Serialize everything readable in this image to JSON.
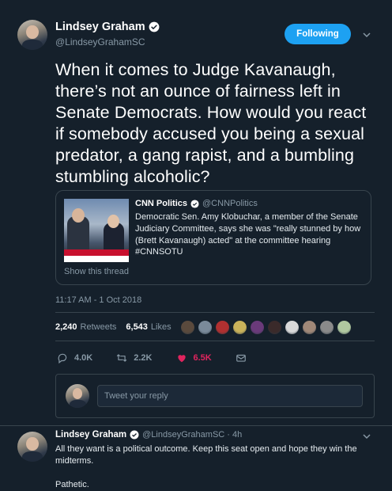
{
  "tweet": {
    "author_name": "Lindsey Graham",
    "handle": "@LindseyGrahamSC",
    "follow_label": "Following",
    "text": "When it comes to Judge Kavanaugh, there’s not an ounce of fairness left in Senate Democrats. How would you react if somebody accused you being a sexual predator, a gang rapist, and a bumbling stumbling alcoholic?",
    "timestamp": "11:17 AM - 1 Oct 2018"
  },
  "quoted_tweet": {
    "author_name": "CNN Politics",
    "handle": "@CNNPolitics",
    "text": "Democratic Sen. Amy Klobuchar, a member of the Senate Judiciary Committee, says she was \"really stunned by how (Brett Kavanaugh) acted\" at the committee hearing #CNNSOTU",
    "show_thread": "Show this thread"
  },
  "stats": {
    "retweets_count": "2,240",
    "retweets_label": "Retweets",
    "likes_count": "6,543",
    "likes_label": "Likes"
  },
  "likers_colors": [
    "#5a4a3d",
    "#7a8a9a",
    "#b03030",
    "#c9b25a",
    "#6a3a7a",
    "#3a2a2a",
    "#d9d9d9",
    "#a08878",
    "#8a8a8a",
    "#b0c8a0"
  ],
  "actions": {
    "reply_count": "4.0K",
    "retweet_count": "2.2K",
    "like_count": "6.5K"
  },
  "reply_box": {
    "placeholder": "Tweet your reply"
  },
  "reply_tweet": {
    "author_name": "Lindsey Graham",
    "handle_time": "@LindseyGrahamSC · 4h",
    "text": "All they want is a political outcome. Keep this seat open and hope they win the midterms.",
    "text2": "Pathetic."
  },
  "colors": {
    "background": "#15202b",
    "accent": "#1da1f2",
    "like": "#e0245e",
    "muted": "#8899a6"
  }
}
